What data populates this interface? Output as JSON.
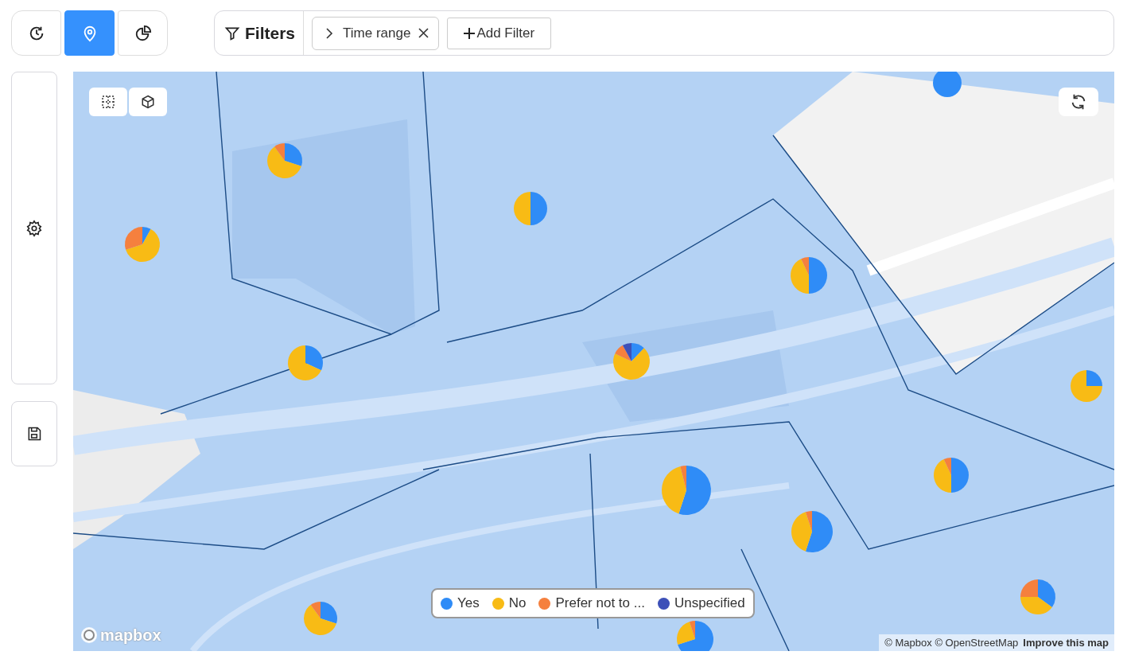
{
  "view_buttons": [
    {
      "kind": "history",
      "selected": false
    },
    {
      "kind": "map",
      "selected": true
    },
    {
      "kind": "chart",
      "selected": false
    }
  ],
  "filters": {
    "title": "Filters",
    "chips": [
      {
        "label": "Time range"
      }
    ],
    "add_button": "Add Filter"
  },
  "map": {
    "legend": [
      {
        "label": "Yes",
        "color": "#2f8cf7"
      },
      {
        "label": "No",
        "color": "#f8bb15"
      },
      {
        "label": "Prefer not to ...",
        "color": "#f5803e"
      },
      {
        "label": "Unspecified",
        "color": "#3d50b8"
      }
    ],
    "logo": "mapbox",
    "attribution": "© Mapbox © OpenStreetMap",
    "improve_link": "Improve this map"
  }
}
